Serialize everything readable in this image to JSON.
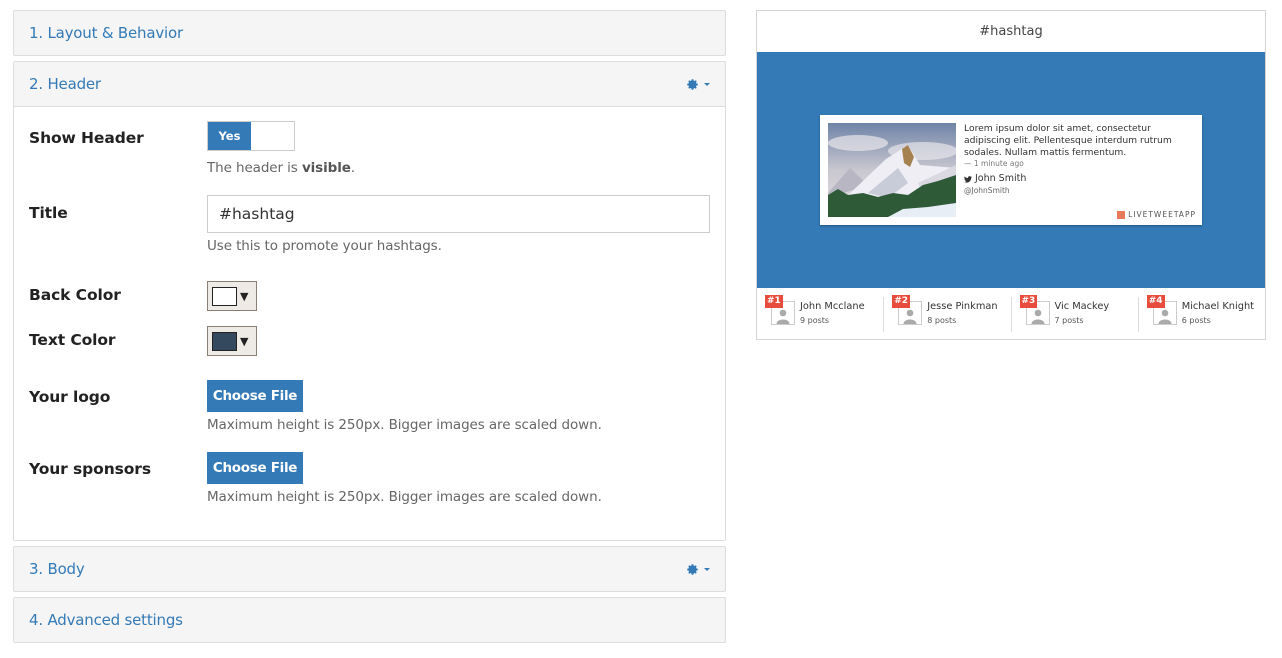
{
  "panels": [
    {
      "title": "1. Layout & Behavior",
      "has_settings": false
    },
    {
      "title": "2. Header",
      "has_settings": true
    },
    {
      "title": "3. Body",
      "has_settings": true
    },
    {
      "title": "4. Advanced settings",
      "has_settings": false
    }
  ],
  "header_form": {
    "show_header": {
      "label": "Show Header",
      "toggle_on_label": "Yes",
      "value": true,
      "help_prefix": "The header is ",
      "help_state": "visible",
      "help_suffix": "."
    },
    "title": {
      "label": "Title",
      "value": "#hashtag",
      "help": "Use this to promote your hashtags."
    },
    "back_color": {
      "label": "Back Color",
      "value": "#ffffff"
    },
    "text_color": {
      "label": "Text Color",
      "value": "#34495e"
    },
    "logo": {
      "label": "Your logo",
      "button": "Choose File",
      "help": "Maximum height is 250px. Bigger images are scaled down."
    },
    "sponsors": {
      "label": "Your sponsors",
      "button": "Choose File",
      "help": "Maximum height is 250px. Bigger images are scaled down."
    }
  },
  "icons": {
    "settings": "gear-icon",
    "dropdown": "caret-down-icon",
    "color_dropdown": "▼"
  },
  "preview": {
    "header_title": "#hashtag",
    "body_color": "#337ab7",
    "tweet": {
      "text": "Lorem ipsum dolor sit amet, consectetur adipiscing elit. Pellentesque interdum rutrum sodales. Nullam mattis fermentum.",
      "time": "— 1 minute ago",
      "author": "John Smith",
      "handle": "@JohnSmith",
      "brand": "LIVETWEETAPP"
    },
    "leaders": [
      {
        "rank": "#1",
        "name": "John Mcclane",
        "posts": "9 posts"
      },
      {
        "rank": "#2",
        "name": "Jesse Pinkman",
        "posts": "8 posts"
      },
      {
        "rank": "#3",
        "name": "Vic Mackey",
        "posts": "7 posts"
      },
      {
        "rank": "#4",
        "name": "Michael Knight",
        "posts": "6 posts"
      }
    ]
  },
  "colors": {
    "accent": "#337ab7",
    "rank_badge": "#e74c3c"
  }
}
